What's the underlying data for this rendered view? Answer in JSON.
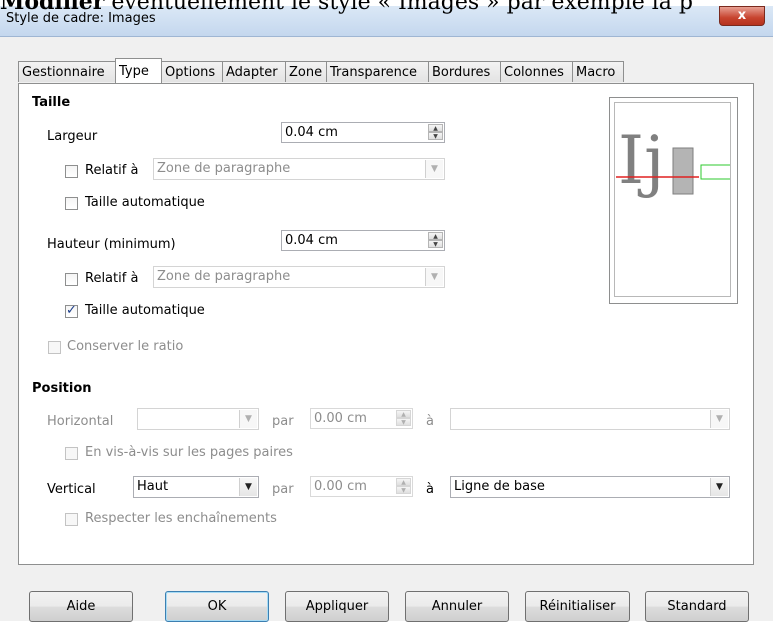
{
  "background_text": {
    "bold": "Modifier",
    "rest": " éventuellement le style « Images » par exemple la p"
  },
  "window": {
    "title": "Style de cadre: Images",
    "close_label": "x"
  },
  "tabs": [
    "Gestionnaire",
    "Type",
    "Options",
    "Adapter",
    "Zone",
    "Transparence",
    "Bordures",
    "Colonnes",
    "Macro"
  ],
  "selected_tab": "Type",
  "taille": {
    "heading": "Taille",
    "largeur_label": "Largeur",
    "largeur_value": "0.04 cm",
    "relatif_label": "Relatif à",
    "relatif_value": "Zone de paragraphe",
    "auto_label": "Taille automatique",
    "hauteur_label": "Hauteur (minimum)",
    "hauteur_value": "0.04 cm",
    "relatif2_label": "Relatif à",
    "relatif2_value": "Zone de paragraphe",
    "auto2_label": "Taille automatique",
    "auto2_checked": true,
    "ratio_label": "Conserver le ratio"
  },
  "position": {
    "heading": "Position",
    "horizontal_label": "Horizontal",
    "horizontal_value": "",
    "par_label": "par",
    "par_value": "0.00 cm",
    "a_label": "à",
    "a_value": "",
    "visavis_label": "En vis-à-vis sur les pages paires",
    "vertical_label": "Vertical",
    "vertical_value": "Haut",
    "par2_label": "par",
    "par2_value": "0.00 cm",
    "a2_label": "à",
    "a2_value": "Ligne de base",
    "enchainements_label": "Respecter les enchaînements"
  },
  "preview": {
    "glyphs": "Ij",
    "colors": {
      "baseline": "#e02020",
      "frame": "#2ec82e",
      "box": "#b4b4b4",
      "text": "#808080"
    }
  },
  "buttons": {
    "aide": "Aide",
    "ok": "OK",
    "appliquer": "Appliquer",
    "annuler": "Annuler",
    "reinitialiser": "Réinitialiser",
    "standard": "Standard"
  }
}
